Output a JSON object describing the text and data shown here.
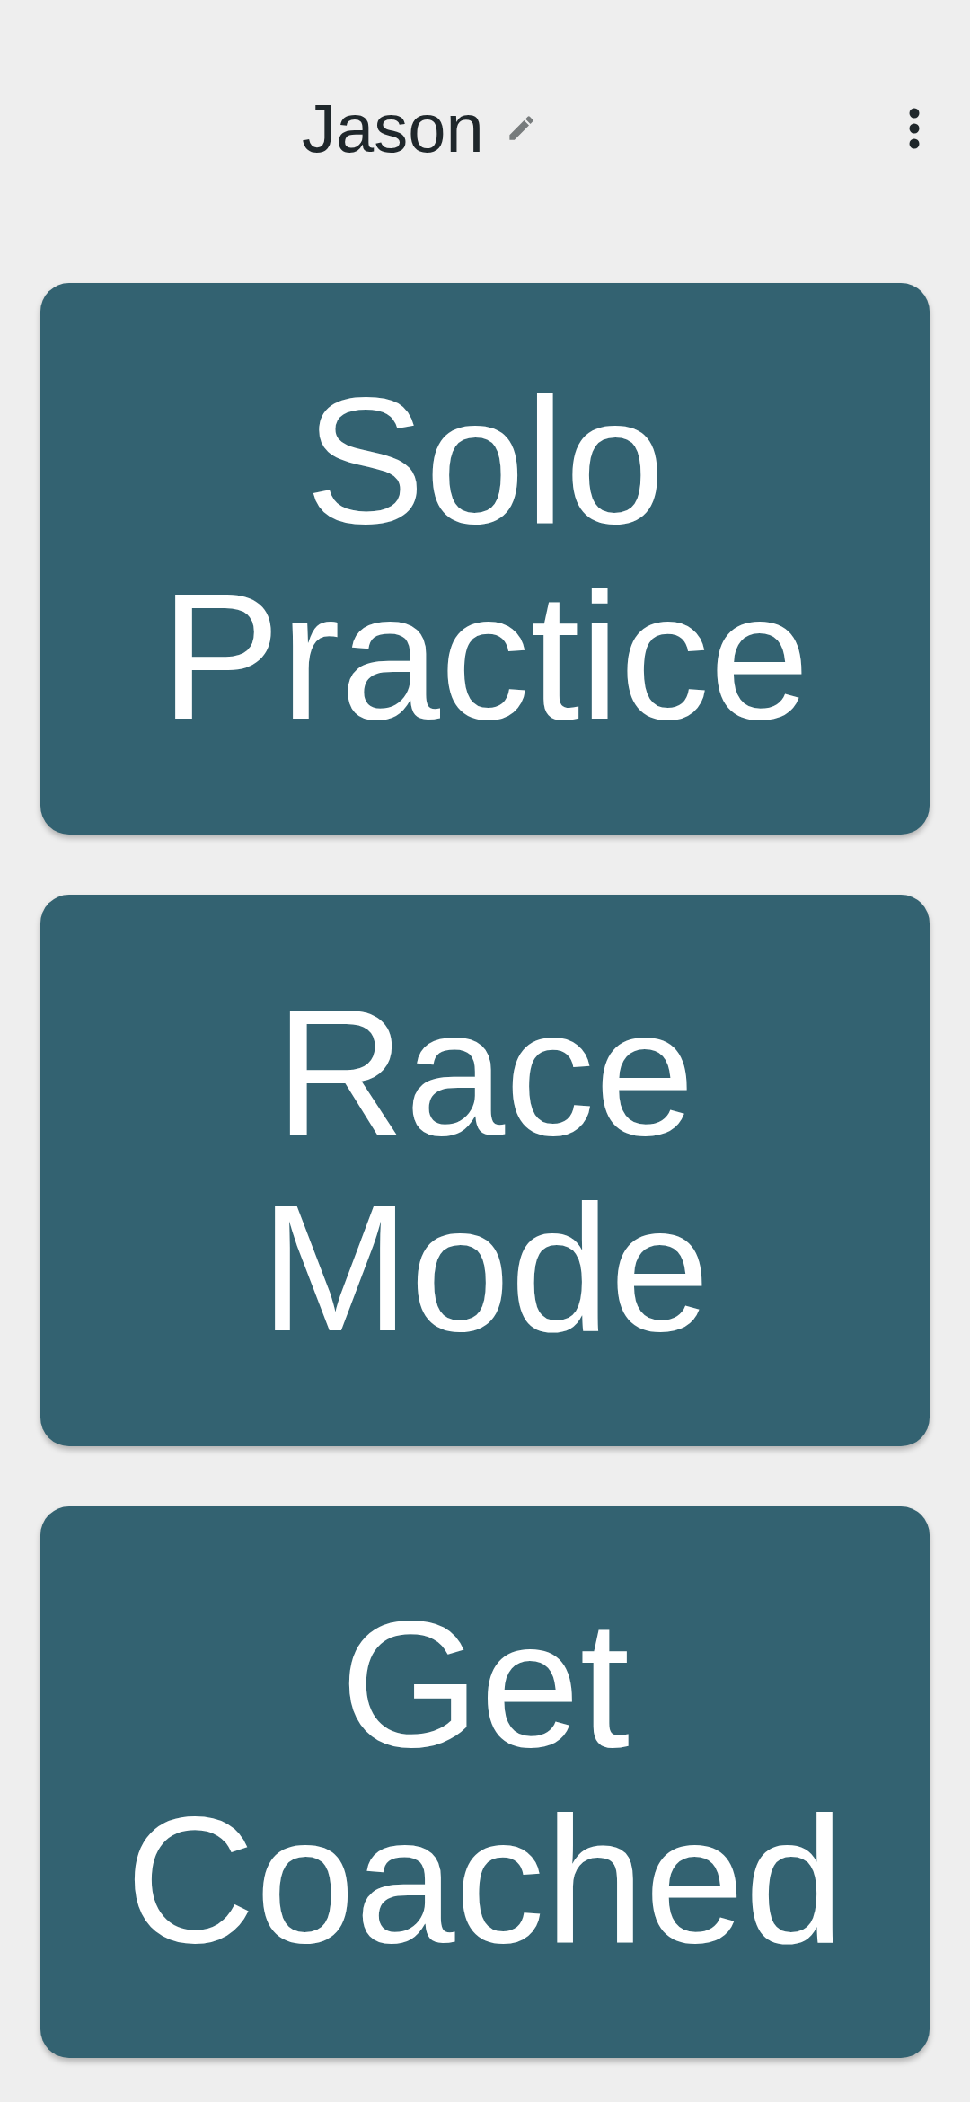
{
  "header": {
    "title": "Jason"
  },
  "modes": [
    {
      "label": "Solo Practice"
    },
    {
      "label": "Race Mode"
    },
    {
      "label": "Get Coached"
    }
  ]
}
